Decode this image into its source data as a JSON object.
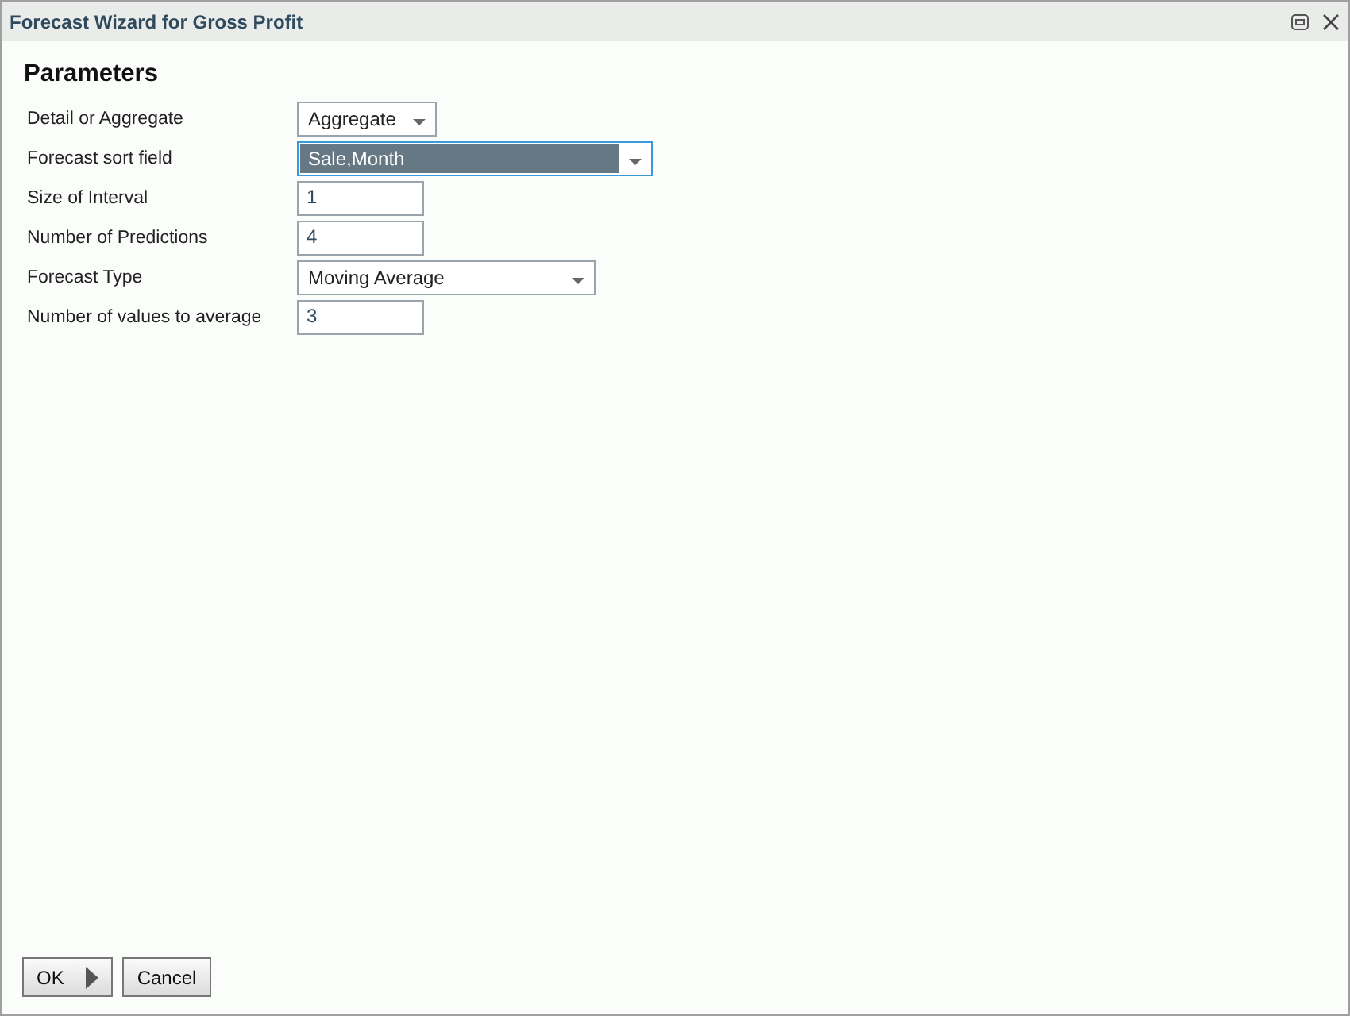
{
  "window": {
    "title": "Forecast Wizard for Gross Profit"
  },
  "heading": "Parameters",
  "fields": [
    {
      "label": "Detail or Aggregate",
      "kind": "select",
      "value": "Aggregate",
      "focused": false
    },
    {
      "label": "Forecast sort field",
      "kind": "select",
      "value": "Sale,Month",
      "focused": true
    },
    {
      "label": "Size of Interval",
      "kind": "input",
      "value": "1",
      "focused": false
    },
    {
      "label": "Number of Predictions",
      "kind": "input",
      "value": "4",
      "focused": false
    },
    {
      "label": "Forecast Type",
      "kind": "select",
      "value": "Moving Average",
      "focused": false
    },
    {
      "label": "Number of values to average",
      "kind": "input",
      "value": "3",
      "focused": false
    }
  ],
  "buttons": [
    {
      "label": "OK",
      "kind": "next"
    },
    {
      "label": "Cancel",
      "kind": "plain"
    }
  ]
}
